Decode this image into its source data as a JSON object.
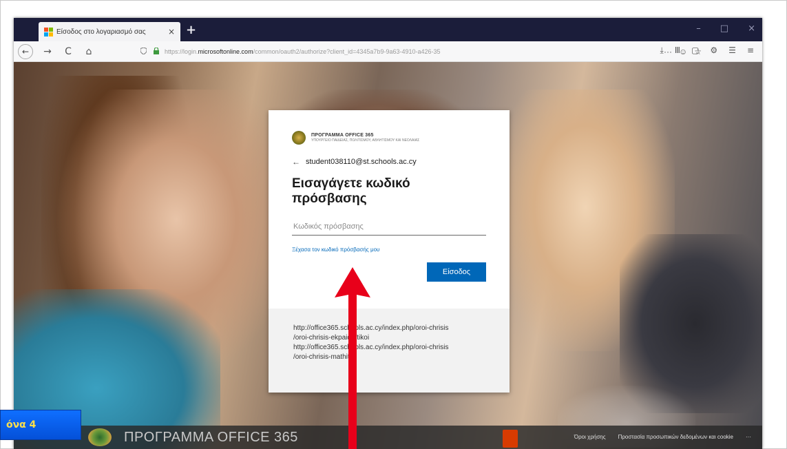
{
  "browser": {
    "tab_title": "Είσοδος στο λογαριασμό σας",
    "tab_close": "×",
    "new_tab": "+",
    "window_controls": [
      "–",
      "□",
      "×"
    ],
    "nav": {
      "back": "←",
      "forward": "→",
      "reload": "C",
      "home": "⌂"
    },
    "url": {
      "prefix": "https://login.",
      "domain": "microsoftonline.com",
      "path": "/common/oauth2/authorize?client_id=4345a7b9-9a63-4910-a426-35"
    },
    "url_actions": [
      "···",
      "☺",
      "☆"
    ],
    "toolbar_icons": [
      "⤓",
      "Ⅲ",
      "▢",
      "⚙",
      "☰",
      "≡"
    ]
  },
  "login": {
    "org_name": "ΠΡΟΓΡΑΜΜΑ OFFICE 365",
    "org_sub": "ΥΠΟΥΡΓΕΙΟ ΠΑΙΔΕΙΑΣ, ΠΟΛΙΤΙΣΜΟΥ, ΑΘΛΗΤΙΣΜΟΥ ΚΑΙ ΝΕΟΛΑΙΑΣ",
    "identity_back": "←",
    "identity": "student038110@st.schools.ac.cy",
    "heading": "Εισαγάγετε κωδικό πρόσβασης",
    "password_placeholder": "Κωδικός πρόσβασης",
    "forgot_link": "Ξέχασα τον κωδικό πρόσβασής μου",
    "signin_button": "Είσοδος",
    "footer_lines": [
      "http://office365.schools.ac.cy/index.php/oroi-chrisis",
      "/oroi-chrisis-ekpaideftikoi",
      "http://office365.schools.ac.cy/index.php/oroi-chrisis",
      "/oroi-chrisis-mathites"
    ]
  },
  "page_footer": {
    "title": "ΠΡΟΓΡΑΜΜΑ OFFICE 365",
    "links": [
      "Όροι χρήσης",
      "Προστασία προσωπικών δεδομένων και cookie",
      "···"
    ]
  },
  "caption": {
    "text": "όνα 4"
  },
  "colors": {
    "accent": "#0067b8",
    "arrow": "#e8001a",
    "caption_bg": "#0450d8",
    "caption_text": "#ffe04a"
  }
}
